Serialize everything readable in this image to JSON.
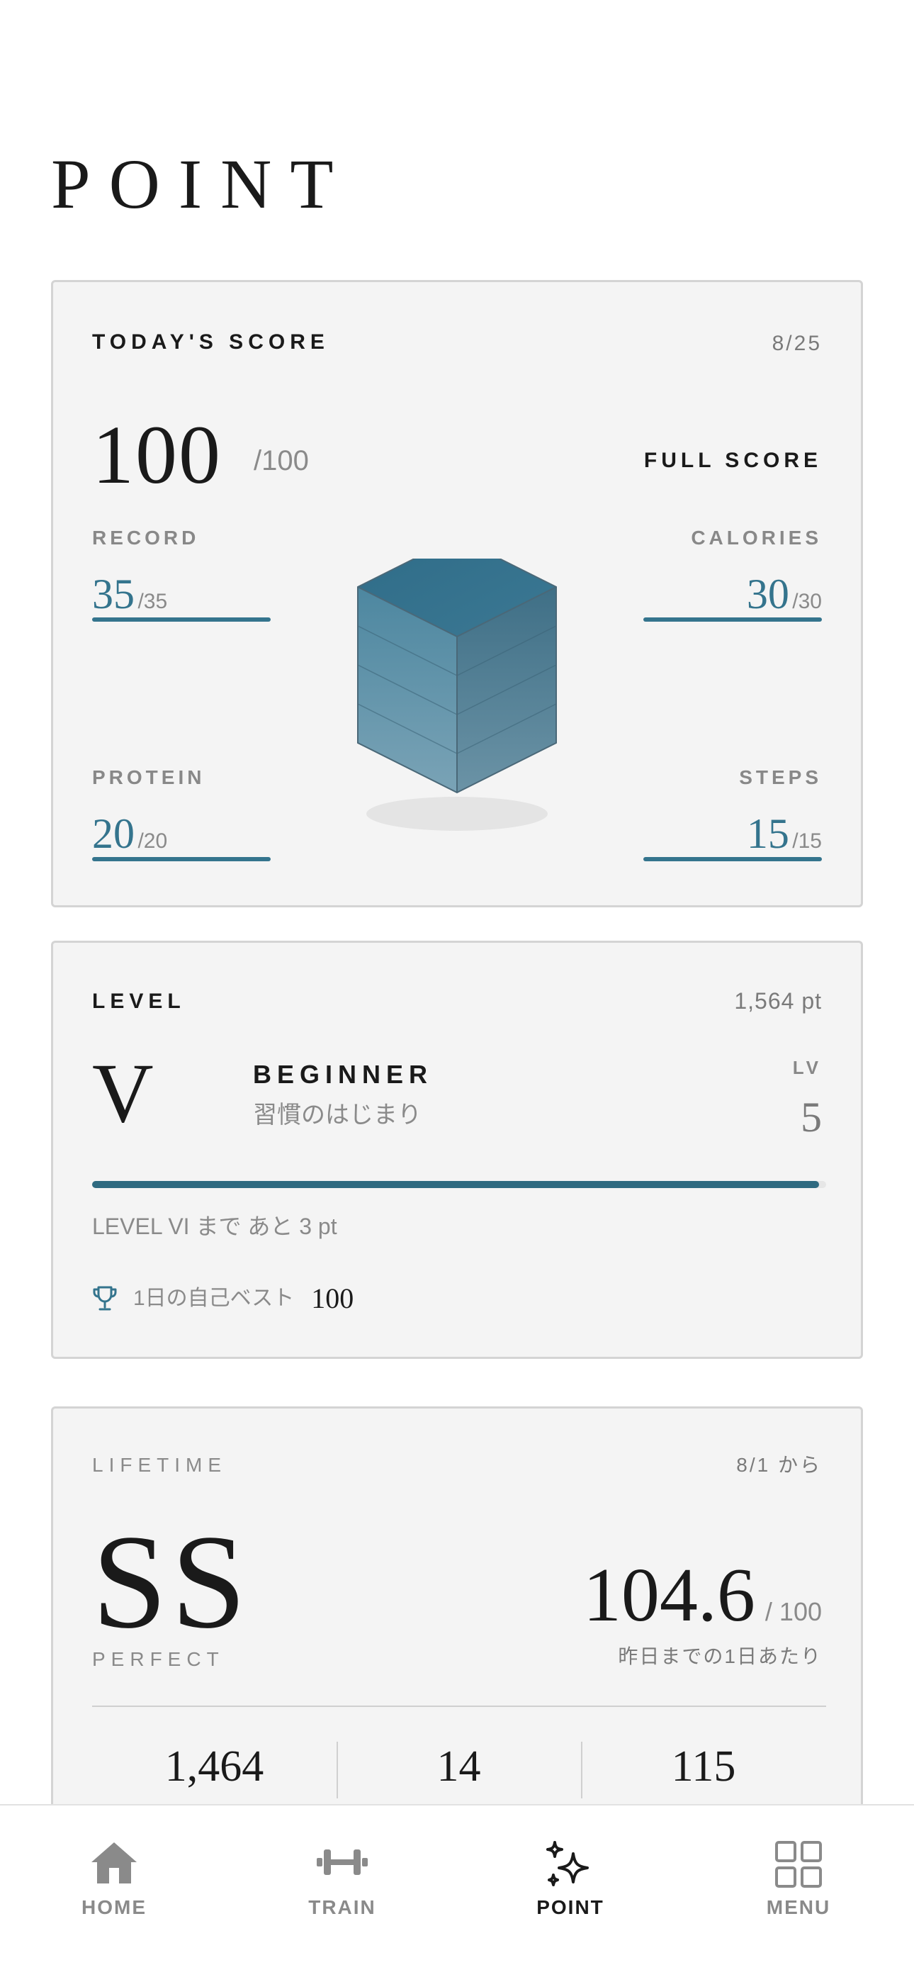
{
  "page": {
    "title": "POINT"
  },
  "score_card": {
    "label": "TODAY'S SCORE",
    "date": "8/25",
    "score": "100",
    "score_max": "/100",
    "badge": "FULL SCORE",
    "metrics": {
      "record": {
        "label": "RECORD",
        "value": "35",
        "max": "/35",
        "fraction": 1.0
      },
      "calories": {
        "label": "CALORIES",
        "value": "30",
        "max": "/30",
        "fraction": 1.0
      },
      "protein": {
        "label": "PROTEIN",
        "value": "20",
        "max": "/20",
        "fraction": 1.0
      },
      "steps": {
        "label": "STEPS",
        "value": "15",
        "max": "/15",
        "fraction": 1.0
      }
    },
    "cube_color": "#34748d"
  },
  "level_card": {
    "label": "LEVEL",
    "points": "1,564 pt",
    "roman": "V",
    "name": "BEGINNER",
    "subtitle": "習慣のはじまり",
    "lv_label": "LV",
    "lv_value": "5",
    "progress": 0.99,
    "next_text": "LEVEL VI まで あと 3 pt",
    "best_label": "1日の自己ベスト",
    "best_value": "100",
    "trophy_icon": "trophy-icon"
  },
  "lifetime_card": {
    "label": "LIFETIME",
    "since": "8/1 から",
    "grade": "SS",
    "grade_label": "PERFECT",
    "average": "104.6",
    "average_max": "/ 100",
    "average_note": "昨日までの1日あたり",
    "stats": [
      "1,464",
      "14",
      "115"
    ]
  },
  "nav": {
    "items": [
      {
        "label": "HOME",
        "icon": "home-icon",
        "active": false
      },
      {
        "label": "TRAIN",
        "icon": "dumbbell-icon",
        "active": false
      },
      {
        "label": "POINT",
        "icon": "sparkle-icon",
        "active": true
      },
      {
        "label": "MENU",
        "icon": "grid-icon",
        "active": false
      }
    ]
  },
  "colors": {
    "accent": "#34748d",
    "card_bg": "#f4f4f4",
    "text": "#1a1a1a",
    "muted": "#8a8a8a"
  }
}
